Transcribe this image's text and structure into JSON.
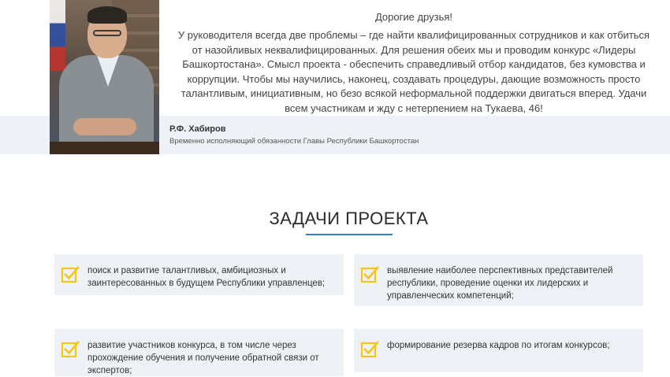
{
  "message": {
    "greeting": "Дорогие друзья!",
    "lines": [
      "У руководителя всегда две проблемы – где найти квалифицированных сотрудников и как отбиться",
      "от назойливых неквалифицированных. Для решения обеих мы и проводим конкурс «Лидеры",
      "Башкортостана». Смысл проекта - обеспечить справедливый отбор кандидатов, без кумовства и",
      "коррупции. Чтобы мы научились, наконец, создавать процедуры, дающие возможность просто",
      "талантливым, инициативным, но безо всякой неформальной поддержки двигаться вперед. Удачи",
      "всем участникам и жду с нетерпением на Тукаева, 46!"
    ]
  },
  "author": {
    "name": "Р.Ф. Хабиров",
    "title": "Временно исполняющий обязанности Главы Республики Башкортостан"
  },
  "tasks_section": {
    "title": "ЗАДАЧИ ПРОЕКТА",
    "accent_color": "#3a7bd5",
    "check_color": "#f5c518",
    "items": [
      {
        "icon": "checkbox-checked-icon",
        "lines": [
          "поиск и развитие талантливых, амбициозных и",
          "заинтересованных в будущем Республики управленцев;"
        ]
      },
      {
        "icon": "checkbox-checked-icon",
        "lines": [
          "выявление наиболее перспективных представителей",
          "республики, проведение оценки их лидерских и",
          "управленческих компетенций;"
        ]
      },
      {
        "icon": "checkbox-checked-icon",
        "lines": [
          "развитие участников конкурса, в том числе через",
          "прохождение обучения и получение обратной связи от",
          "экспертов;"
        ]
      },
      {
        "icon": "checkbox-checked-icon",
        "lines": [
          "формирование резерва кадров по итогам конкурсов;"
        ]
      }
    ]
  }
}
